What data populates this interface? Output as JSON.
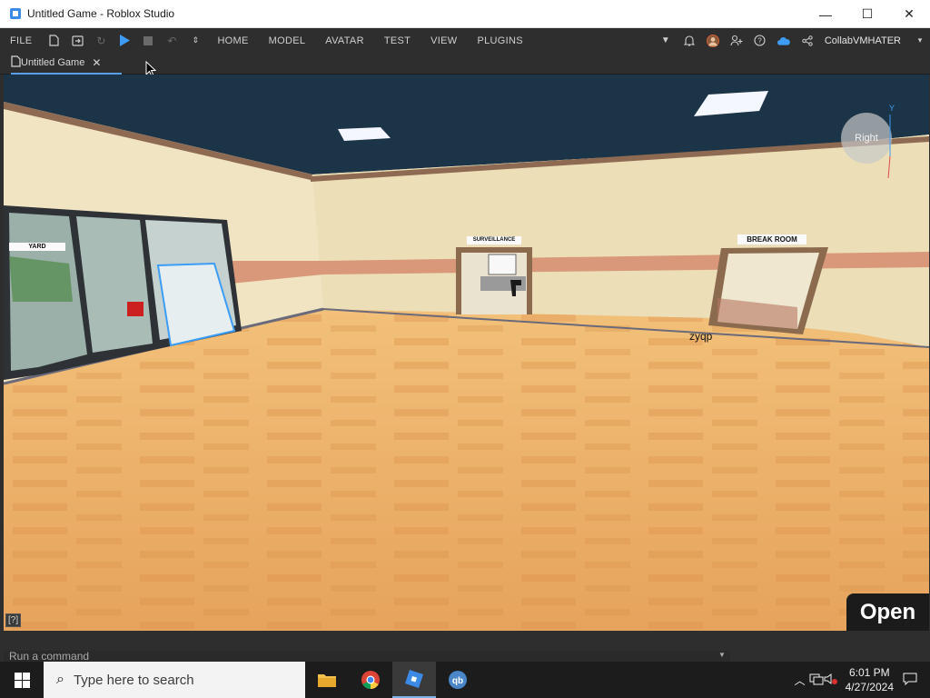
{
  "window": {
    "title": "Untitled Game - Roblox Studio",
    "minimize": "—",
    "maximize": "☐",
    "close": "✕"
  },
  "ribbon": {
    "file": "FILE",
    "tabs": [
      "HOME",
      "MODEL",
      "AVATAR",
      "TEST",
      "VIEW",
      "PLUGINS"
    ],
    "username": "CollabVMHATER"
  },
  "document_tab": {
    "label": "Untitled Game",
    "close": "✕"
  },
  "viewport": {
    "help": "[?]",
    "open_button": "Open",
    "player_name": "zyqp",
    "view_cube_label": "Right",
    "axis_y": "Y",
    "signs": {
      "yard": "YARD",
      "surveillance": "SURVEILLANCE",
      "break_room": "BREAK ROOM"
    }
  },
  "command_bar": {
    "placeholder": "Run a command"
  },
  "taskbar": {
    "search_placeholder": "Type here to search",
    "time": "6:01 PM",
    "date": "4/27/2024"
  },
  "colors": {
    "accent": "#5aa0e8",
    "play": "#3d9df5",
    "dark_bg": "#2e2e2e",
    "ceiling": "#1c3447",
    "floor": "#e8a865"
  }
}
